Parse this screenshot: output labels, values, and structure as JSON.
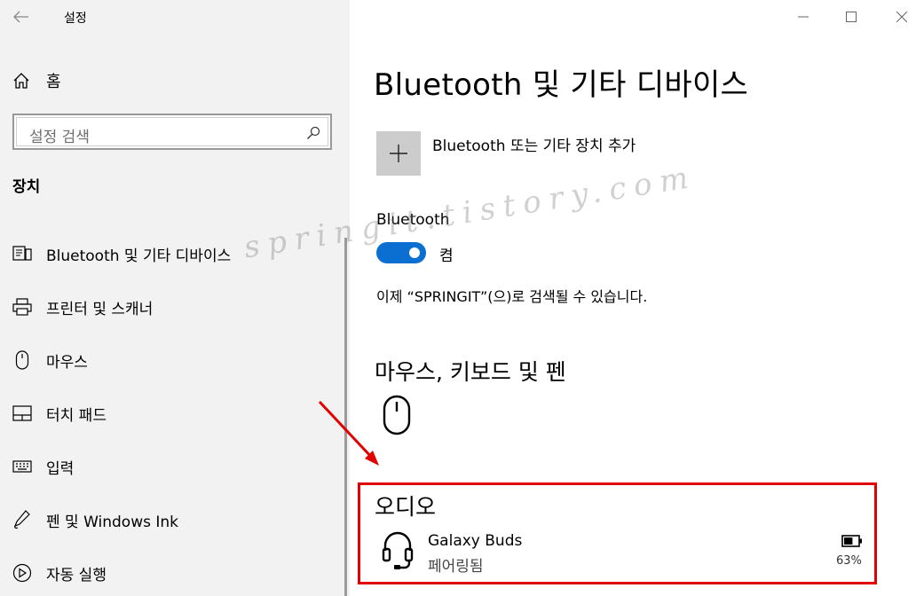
{
  "window": {
    "title": "설정",
    "controls": {
      "minimize": "minimize-icon",
      "maximize": "maximize-icon",
      "close": "close-icon"
    }
  },
  "sidebar": {
    "home_label": "홈",
    "search_placeholder": "설정 검색",
    "section_title": "장치",
    "items": [
      {
        "label": "Bluetooth 및 기타 디바이스",
        "icon": "bluetooth-devices-icon"
      },
      {
        "label": "프린터 및 스캐너",
        "icon": "printer-icon"
      },
      {
        "label": "마우스",
        "icon": "mouse-icon"
      },
      {
        "label": "터치 패드",
        "icon": "touchpad-icon"
      },
      {
        "label": "입력",
        "icon": "keyboard-icon"
      },
      {
        "label": "펜 및 Windows Ink",
        "icon": "pen-icon"
      },
      {
        "label": "자동 실행",
        "icon": "autoplay-icon"
      }
    ]
  },
  "main": {
    "title": "Bluetooth 및 기타 디바이스",
    "add_device_label": "Bluetooth 또는 기타 장치 추가",
    "bluetooth": {
      "label": "Bluetooth",
      "state_label": "켬",
      "on": true,
      "discoverable_text": "이제 “SPRINGIT”(으)로 검색될 수 있습니다."
    },
    "input_section_title": "마우스, 키보드 및 펜",
    "audio_section_title": "오디오",
    "audio_device": {
      "name": "Galaxy Buds",
      "status": "페어링됨",
      "battery_percent": "63%",
      "battery_level": 0.63
    },
    "accent_color": "#0a6fd1",
    "highlight_color": "#e00000"
  },
  "watermark": "springit.tistory.com"
}
